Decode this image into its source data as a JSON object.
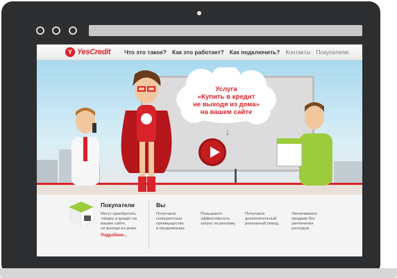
{
  "site": {
    "logo_text": "YesCredit",
    "logo_mark": "Y"
  },
  "nav": [
    {
      "label": "Что это такое?"
    },
    {
      "label": "Как это работает?"
    },
    {
      "label": "Как подключить?"
    },
    {
      "label": "Контакты"
    },
    {
      "label": "Покупателю"
    }
  ],
  "hero": {
    "cloud_lines": [
      "Услуга",
      "«Купить в кредит",
      "не выходя из дома»",
      "на вашем сайте"
    ]
  },
  "buyers": {
    "title": "Покупатели",
    "text_lines": [
      "Могут приобретать",
      "товары в кредит на",
      "вашем сайте,",
      "не выходя из дома."
    ],
    "more_link": "Подробнее..."
  },
  "you": {
    "title": "Вы",
    "columns": [
      [
        "Получаете",
        "конкурентные",
        "преимущества",
        "в продвижении."
      ],
      [
        "Повышаете",
        "эффективность",
        "затрат на рекламу."
      ],
      [
        "Получаете",
        "дополнительный",
        "рекламный повод."
      ],
      [
        "Увеличиваете",
        "продажи без",
        "увеличения",
        "расходов."
      ]
    ]
  },
  "colors": {
    "brand_red": "#d8232a",
    "laptop_frame": "#2d2e30"
  }
}
